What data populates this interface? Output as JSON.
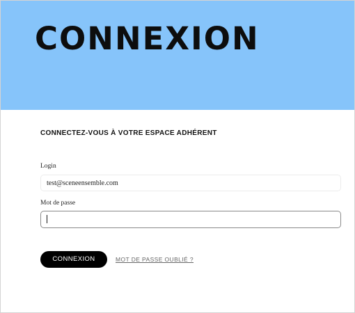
{
  "hero": {
    "title": "CONNEXION",
    "background_color": "#86c4fa"
  },
  "login_form": {
    "heading": "CONNECTEZ-VOUS À VOTRE ESPACE ADHÉRENT",
    "login": {
      "label": "Login",
      "value": "test@sceneensemble.com"
    },
    "password": {
      "label": "Mot de passe",
      "value": ""
    },
    "submit_label": "CONNEXION",
    "forgot_password_label": "MOT DE PASSE OUBLIÉ ?"
  }
}
